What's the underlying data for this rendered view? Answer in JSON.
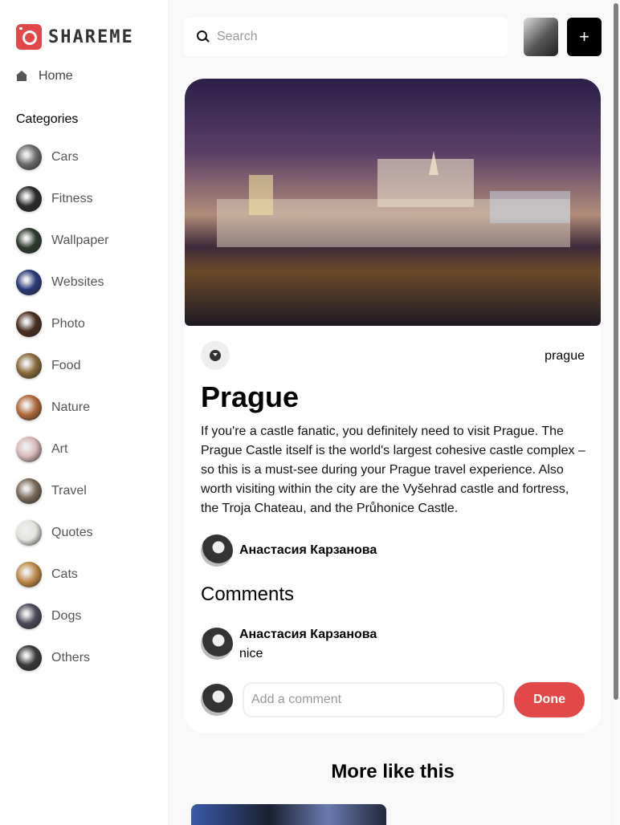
{
  "app": {
    "logo_text": "SHAREME"
  },
  "sidebar": {
    "home_label": "Home",
    "categories_heading": "Categories",
    "categories": [
      {
        "label": "Cars",
        "color": "#6b6b6b"
      },
      {
        "label": "Fitness",
        "color": "#2b2b2b"
      },
      {
        "label": "Wallpaper",
        "color": "#2e3a2e"
      },
      {
        "label": "Websites",
        "color": "#2a3a7a"
      },
      {
        "label": "Photo",
        "color": "#4a2e1e"
      },
      {
        "label": "Food",
        "color": "#8a6a3a"
      },
      {
        "label": "Nature",
        "color": "#b06a3a"
      },
      {
        "label": "Art",
        "color": "#d8b8b8"
      },
      {
        "label": "Travel",
        "color": "#7a6a5a"
      },
      {
        "label": "Quotes",
        "color": "#e4e2dc"
      },
      {
        "label": "Cats",
        "color": "#c08a4a"
      },
      {
        "label": "Dogs",
        "color": "#4a4a5a"
      },
      {
        "label": "Others",
        "color": "#3a3a3a"
      }
    ]
  },
  "header": {
    "search_placeholder": "Search",
    "add_label": "+"
  },
  "pin": {
    "tag": "prague",
    "title": "Prague",
    "about": "If you're a castle fanatic, you definitely need to visit Prague. The Prague Castle itself is the world's largest cohesive castle complex – so this is a must-see during your Prague travel experience. Also worth visiting within the city are the Vyšehrad castle and fortress, the Troja Chateau, and the Průhonice Castle.",
    "author": "Анастасия Карзанова"
  },
  "comments": {
    "heading": "Comments",
    "items": [
      {
        "name": "Анастасия Карзанова",
        "text": "nice"
      }
    ],
    "input_placeholder": "Add a comment",
    "done_label": "Done"
  },
  "more": {
    "heading": "More like this"
  },
  "colors": {
    "accent": "#e34848"
  }
}
